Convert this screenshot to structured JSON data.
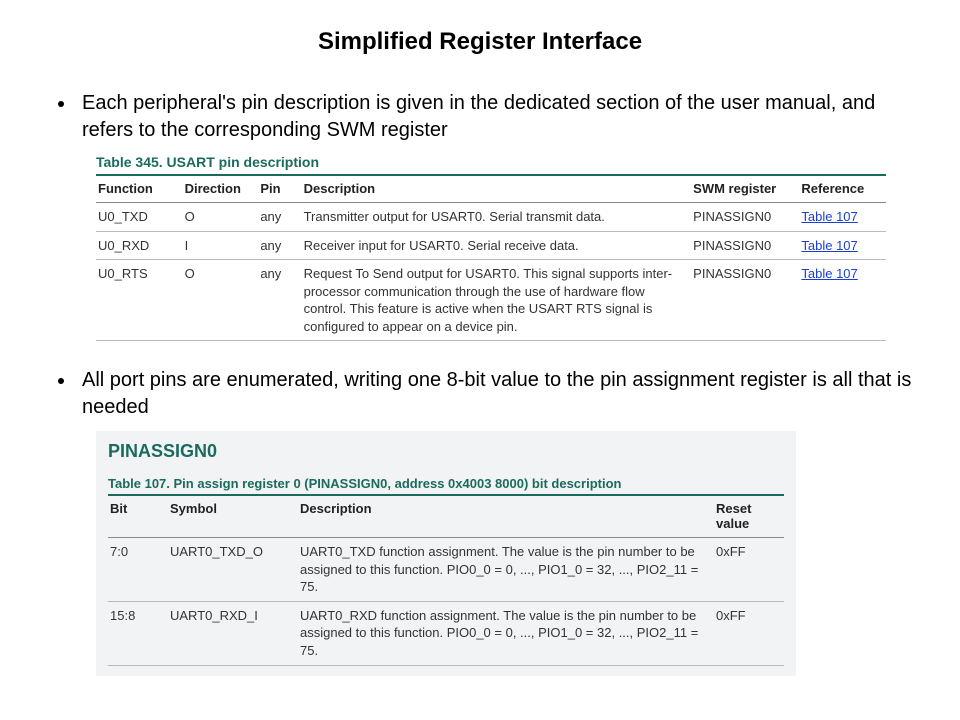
{
  "title": "Simplified Register Interface",
  "bullet1": "Each peripheral's pin description is given in the dedicated section of the user manual, and refers to the corresponding SWM register",
  "bullet2": "All port pins are enumerated, writing one 8-bit value to the pin assignment register is all that is needed",
  "table345": {
    "caption": "Table 345. USART pin description",
    "headers": {
      "function": "Function",
      "direction": "Direction",
      "pin": "Pin",
      "description": "Description",
      "swm": "SWM register",
      "reference": "Reference"
    },
    "rows": [
      {
        "function": "U0_TXD",
        "direction": "O",
        "pin": "any",
        "description": "Transmitter output for USART0. Serial transmit data.",
        "swm": "PINASSIGN0",
        "reference": "Table 107"
      },
      {
        "function": "U0_RXD",
        "direction": "I",
        "pin": "any",
        "description": "Receiver input for USART0. Serial receive data.",
        "swm": "PINASSIGN0",
        "reference": "Table 107"
      },
      {
        "function": "U0_RTS",
        "direction": "O",
        "pin": "any",
        "description": "Request To Send output for USART0. This signal supports inter-processor communication through the use of hardware flow control. This feature is active when the USART RTS signal is configured to appear on a device pin.",
        "swm": "PINASSIGN0",
        "reference": "Table 107"
      }
    ]
  },
  "pinassign": {
    "regname": "PINASSIGN0",
    "caption": "Table 107. Pin assign register 0 (PINASSIGN0, address 0x4003 8000) bit description",
    "headers": {
      "bit": "Bit",
      "symbol": "Symbol",
      "description": "Description",
      "reset": "Reset value"
    },
    "rows": [
      {
        "bit": "7:0",
        "symbol": "UART0_TXD_O",
        "description": "UART0_TXD function assignment. The value is the pin number to be assigned to this function. PIO0_0 = 0, ..., PIO1_0 = 32, ..., PIO2_11 = 75.",
        "reset": "0xFF"
      },
      {
        "bit": "15:8",
        "symbol": "UART0_RXD_I",
        "description": "UART0_RXD function assignment. The value is the pin number to be assigned to this function. PIO0_0 = 0, ..., PIO1_0 = 32, ..., PIO2_11 = 75.",
        "reset": "0xFF"
      }
    ]
  }
}
